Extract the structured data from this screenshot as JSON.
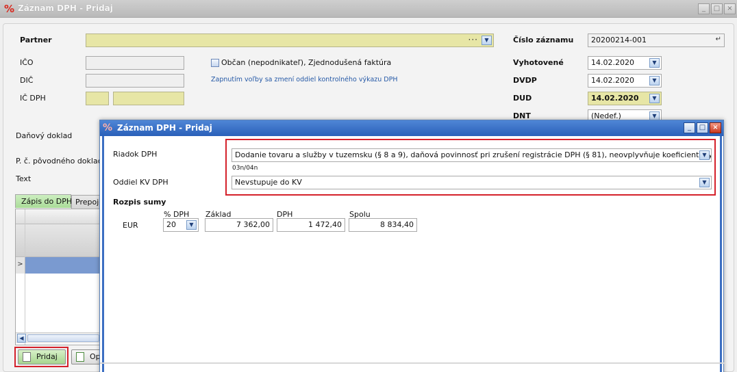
{
  "window": {
    "title": "Záznam DPH - Pridaj",
    "controls": [
      "_",
      "□",
      "×"
    ]
  },
  "form": {
    "partner_label": "Partner",
    "ico_label": "IČO",
    "dic_label": "DIČ",
    "icdph_label": "IČ DPH",
    "obcan_label": "Občan (nepodnikateľ), Zjednodušená faktúra",
    "obcan_hint": "Zapnutím voľby sa zmení oddiel kontrolného výkazu DPH",
    "danovy_doklad_label": "Daňový doklad",
    "pc_povodneho_label": "P. č. pôvodného dokladu",
    "text_label": "Text",
    "cislo_zaznamu_label": "Číslo záznamu",
    "cislo_zaznamu_value": "20200214-001",
    "vyhotovene_label": "Vyhotovené",
    "vyhotovene_value": "14.02.2020",
    "dvdp_label": "DVDP",
    "dvdp_value": "14.02.2020",
    "dud_label": "DUD",
    "dud_value": "14.02.2020",
    "dnt_label": "DNT",
    "dnt_value": "(Nedef.)"
  },
  "tabs": [
    {
      "label": "Zápis do DPH",
      "active": true
    },
    {
      "label": "Prepoje",
      "active": false
    }
  ],
  "buttons": {
    "pridaj": "Pridaj",
    "second": "Op"
  },
  "dialog": {
    "title": "Záznam DPH - Pridaj",
    "riadok_label": "Riadok DPH",
    "riadok_value": "Dodanie tovaru a služby v tuzemsku (§ 8 a 9), daňová povinnosť pri zrušení registrácie DPH (§ 81), neovplyvňuje koeficient, vyššia daň",
    "riadok_code": "03n/04n",
    "oddiel_label": "Oddiel KV DPH",
    "oddiel_value": "Nevstupuje do KV",
    "rozpis_title": "Rozpis sumy",
    "col_dph_pct": "% DPH",
    "col_zaklad": "Základ",
    "col_dph": "DPH",
    "col_spolu": "Spolu",
    "currency": "EUR",
    "dph_pct_value": "20",
    "zaklad_value": "7 362,00",
    "dph_value": "1 472,40",
    "spolu_value": "8 834,40"
  },
  "colors": {
    "accent_blue": "#2a60b9",
    "highlight_red": "#d4202a",
    "field_yellow": "#e7e6a6",
    "tab_green": "#a9dc98"
  }
}
